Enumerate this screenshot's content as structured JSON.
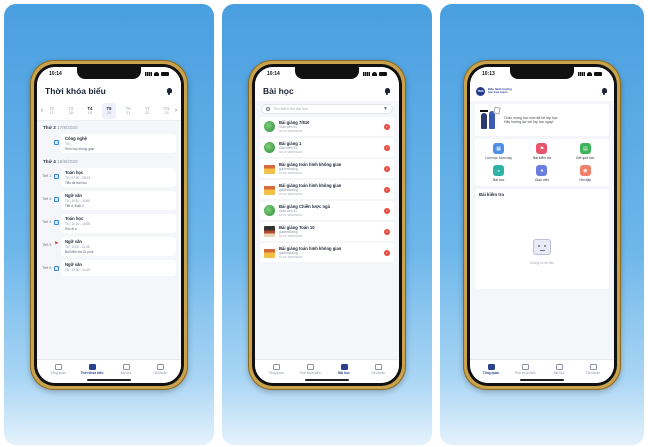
{
  "status": {
    "time1": "10:14",
    "time2": "10:14",
    "time3": "10:13"
  },
  "timetable": {
    "title": "Thời khóa biểu",
    "prev": "‹",
    "next": "›",
    "days": [
      {
        "name": "T2",
        "date": "17",
        "dim": true
      },
      {
        "name": "T3",
        "date": "18",
        "dim": true
      },
      {
        "name": "T4",
        "date": "19",
        "dim": false
      },
      {
        "name": "T5",
        "date": "20",
        "dim": false
      },
      {
        "name": "T6",
        "date": "21",
        "dim": true
      },
      {
        "name": "T7",
        "date": "22",
        "dim": true
      },
      {
        "name": "CN",
        "date": "23",
        "dim": true
      }
    ],
    "section1": {
      "label": "Thứ 2",
      "date": "17/8/2020"
    },
    "section2": {
      "label": "Thứ 4",
      "date": "19/8/2020"
    },
    "lessons": [
      {
        "slot": "",
        "name": "Công nghệ",
        "info": "T5 | -",
        "desc": "Hình học không gian",
        "flag": false
      },
      {
        "slot": "Tiết 1",
        "name": "Toán học",
        "info": "T6 | 07:30 - 08:15",
        "desc": "Tiểu đề bài học",
        "flag": false
      },
      {
        "slot": "Tiết 4",
        "name": "Ngữ văn",
        "info": "T6 | 10:10 - 10:55",
        "desc": "Tiết 4, Buổi 2",
        "flag": false
      },
      {
        "slot": "Tiết 4",
        "name": "Toán học",
        "info": "T6 | 10:10 - 10:55",
        "desc": "Học đi ạ",
        "flag": false
      },
      {
        "slot": "Tiết 5",
        "name": "Ngữ văn",
        "info": "T6 | 11:00 - 11:45",
        "desc": "Bài kiểm tra 15 phút",
        "flag": true
      },
      {
        "slot": "Tiết 6",
        "name": "Ngữ văn",
        "info": "T6 | 13:00 - 14:15",
        "desc": "",
        "flag": false
      }
    ]
  },
  "lessons": {
    "title": "Bài học",
    "search_placeholder": "Tìm kiếm tên bài học",
    "items": [
      {
        "title": "Bài giảng 7/810",
        "teacher": "Giáo viên 41",
        "date": "04:43 18/08/2020",
        "thumb": "globe"
      },
      {
        "title": "Bài giảng 1",
        "teacher": "Giáo viên 41",
        "date": "04:21 18/08/2020",
        "thumb": "globe"
      },
      {
        "title": "Bài giảng toán hình không gian",
        "teacher": "guidemissing",
        "date": "10:52 18/08/2020",
        "thumb": "house"
      },
      {
        "title": "Bài giảng toán hình không gian",
        "teacher": "guidemissing",
        "date": "10:52 18/08/2020",
        "thumb": "house"
      },
      {
        "title": "Bài giảng Chiến lược ngà",
        "teacher": "Giáo viên 41",
        "date": "10:21 18/08/2020",
        "thumb": "globe"
      },
      {
        "title": "Bài giảng Toán 10",
        "teacher": "guidemissing",
        "date": "10:56 18/08/2020",
        "thumb": "bird"
      },
      {
        "title": "Bài giảng toán hình không gian",
        "teacher": "guidemissing",
        "date": "10:56 18/08/2020",
        "thumb": "house"
      }
    ]
  },
  "home": {
    "logo_text": "TMS",
    "brand_line1": "Điều hành trường",
    "brand_line2": "học trực tuyến",
    "welcome_line1": "Chào mừng học sinh đã tới lớp học.",
    "welcome_line2": "Hãy hướng lạc với lớp học ngay!",
    "grid": [
      {
        "label": "Lịch học hôm nay",
        "color": "#4d8fe6",
        "icon": "calendar-icon"
      },
      {
        "label": "Bài kiểm tra",
        "color": "#e8556a",
        "icon": "flag-icon"
      },
      {
        "label": "Kết quả học",
        "color": "#3fb35a",
        "icon": "document-icon"
      },
      {
        "label": "Bài học",
        "color": "#2fb2a8",
        "icon": "bag-icon"
      },
      {
        "label": "Giáo viên",
        "color": "#6a7ee0",
        "icon": "person-icon"
      },
      {
        "label": "Hỏi đáp",
        "color": "#f0806a",
        "icon": "chat-icon"
      }
    ],
    "tests_title": "Bài kiểm tra",
    "empty_text": "Không có dữ liệu"
  },
  "tabs": [
    "Tổng quan",
    "Thời khóa biểu",
    "Bài học",
    "Tài khoản"
  ]
}
